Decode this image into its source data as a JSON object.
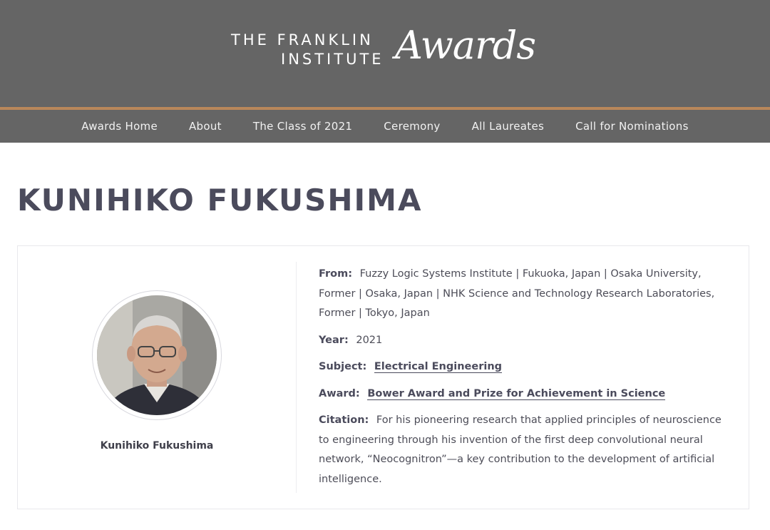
{
  "header": {
    "logo_line1": "THE FRANKLIN",
    "logo_line2": "INSTITUTE",
    "logo_script": "Awards"
  },
  "nav": {
    "items": [
      {
        "label": "Awards Home"
      },
      {
        "label": "About"
      },
      {
        "label": "The Class of 2021"
      },
      {
        "label": "Ceremony"
      },
      {
        "label": "All Laureates"
      },
      {
        "label": "Call for Nominations"
      }
    ]
  },
  "laureate": {
    "name_heading": "KUNIHIKO FUKUSHIMA",
    "photo_caption": "Kunihiko Fukushima",
    "from_label": "From:",
    "from_value": "Fuzzy Logic Systems Institute  |  Fukuoka, Japan  |  Osaka University, Former  |  Osaka, Japan  |  NHK Science and Technology Research Laboratories, Former  |  Tokyo, Japan",
    "year_label": "Year:",
    "year_value": "2021",
    "subject_label": "Subject:",
    "subject_value": "Electrical Engineering",
    "award_label": "Award:",
    "award_value": "Bower Award and Prize for Achievement in Science",
    "citation_label": "Citation:",
    "citation_value": "For his pioneering research that applied principles of neuroscience to engineering through his invention of the first deep convolutional neural network, “Neocognitron”—a key contribution to the development of artificial intelligence."
  },
  "colors": {
    "banner": "#656565",
    "accent_rule": "#b9875a",
    "heading": "#4b4b5c"
  }
}
